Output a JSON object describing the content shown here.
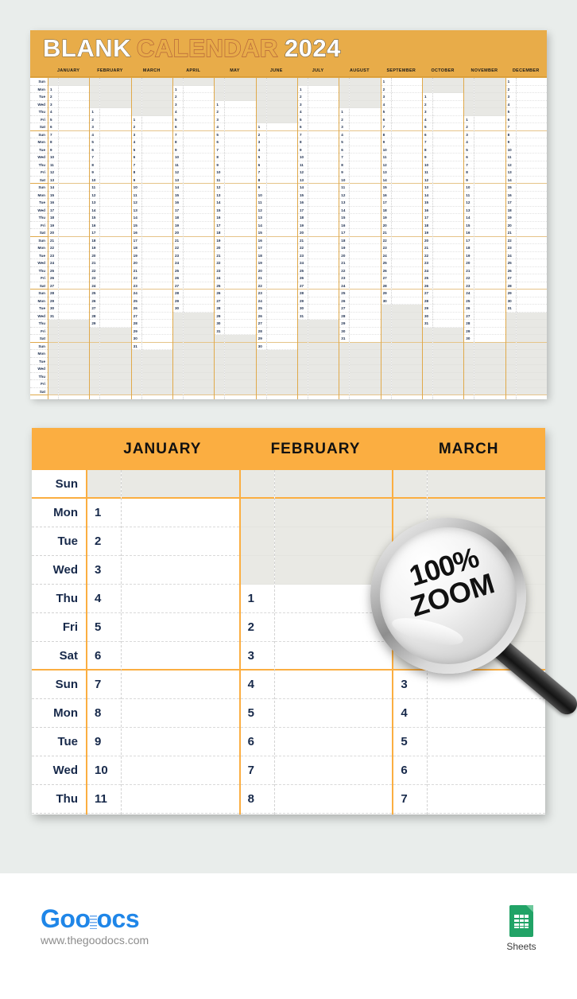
{
  "colors": {
    "page_background": "#e9edeb",
    "banner_orange": "#e8ac49",
    "zoom_banner_orange": "#fbae41",
    "grid_line_orange": "#e0a94a",
    "date_text_navy": "#17294a",
    "blank_cell_gray": "#e8e8e4",
    "goodocs_blue": "#1f86e8",
    "sheets_green": "#21a366"
  },
  "year_calendar": {
    "title_word1": "BLANK",
    "title_word2": "CALENDAR",
    "title_year": "2024",
    "months": [
      "JANUARY",
      "FEBRUARY",
      "MARCH",
      "APRIL",
      "MAY",
      "JUNE",
      "JULY",
      "AUGUST",
      "SEPTEMBER",
      "OCTOBER",
      "NOVEMBER",
      "DECEMBER"
    ],
    "weekday_labels": [
      "Sun",
      "Mon",
      "Tue",
      "Wed",
      "Thu",
      "Fri",
      "Sat"
    ],
    "rows": 42,
    "month_start_offsets": [
      1,
      4,
      5,
      1,
      3,
      6,
      1,
      4,
      0,
      2,
      5,
      0
    ],
    "month_lengths": [
      31,
      29,
      31,
      30,
      31,
      30,
      31,
      31,
      30,
      31,
      30,
      31
    ]
  },
  "zoom_calendar": {
    "months": [
      "JANUARY",
      "FEBRUARY",
      "MARCH"
    ],
    "weekday_labels": [
      "Sun",
      "Mon",
      "Tue",
      "Wed",
      "Thu",
      "Fri",
      "Sat",
      "Sun",
      "Mon",
      "Tue",
      "Wed",
      "Thu"
    ],
    "rows": 12,
    "columns": [
      {
        "month": "JANUARY",
        "dates": [
          "",
          "1",
          "2",
          "3",
          "4",
          "5",
          "6",
          "7",
          "8",
          "9",
          "10",
          "11"
        ]
      },
      {
        "month": "FEBRUARY",
        "dates": [
          "",
          "",
          "",
          "",
          "1",
          "2",
          "3",
          "4",
          "5",
          "6",
          "7",
          "8"
        ]
      },
      {
        "month": "MARCH",
        "dates": [
          "",
          "",
          "",
          "",
          "",
          "",
          "",
          "3",
          "4",
          "5",
          "6",
          "7"
        ]
      }
    ],
    "week_break_after_rows": [
      0,
      6
    ]
  },
  "magnifier": {
    "line1": "100%",
    "line2": "ZOOM"
  },
  "footer": {
    "logo_part1": "Goo",
    "logo_part2": "ocs",
    "url": "www.thegoodocs.com",
    "badge_label": "Sheets"
  }
}
